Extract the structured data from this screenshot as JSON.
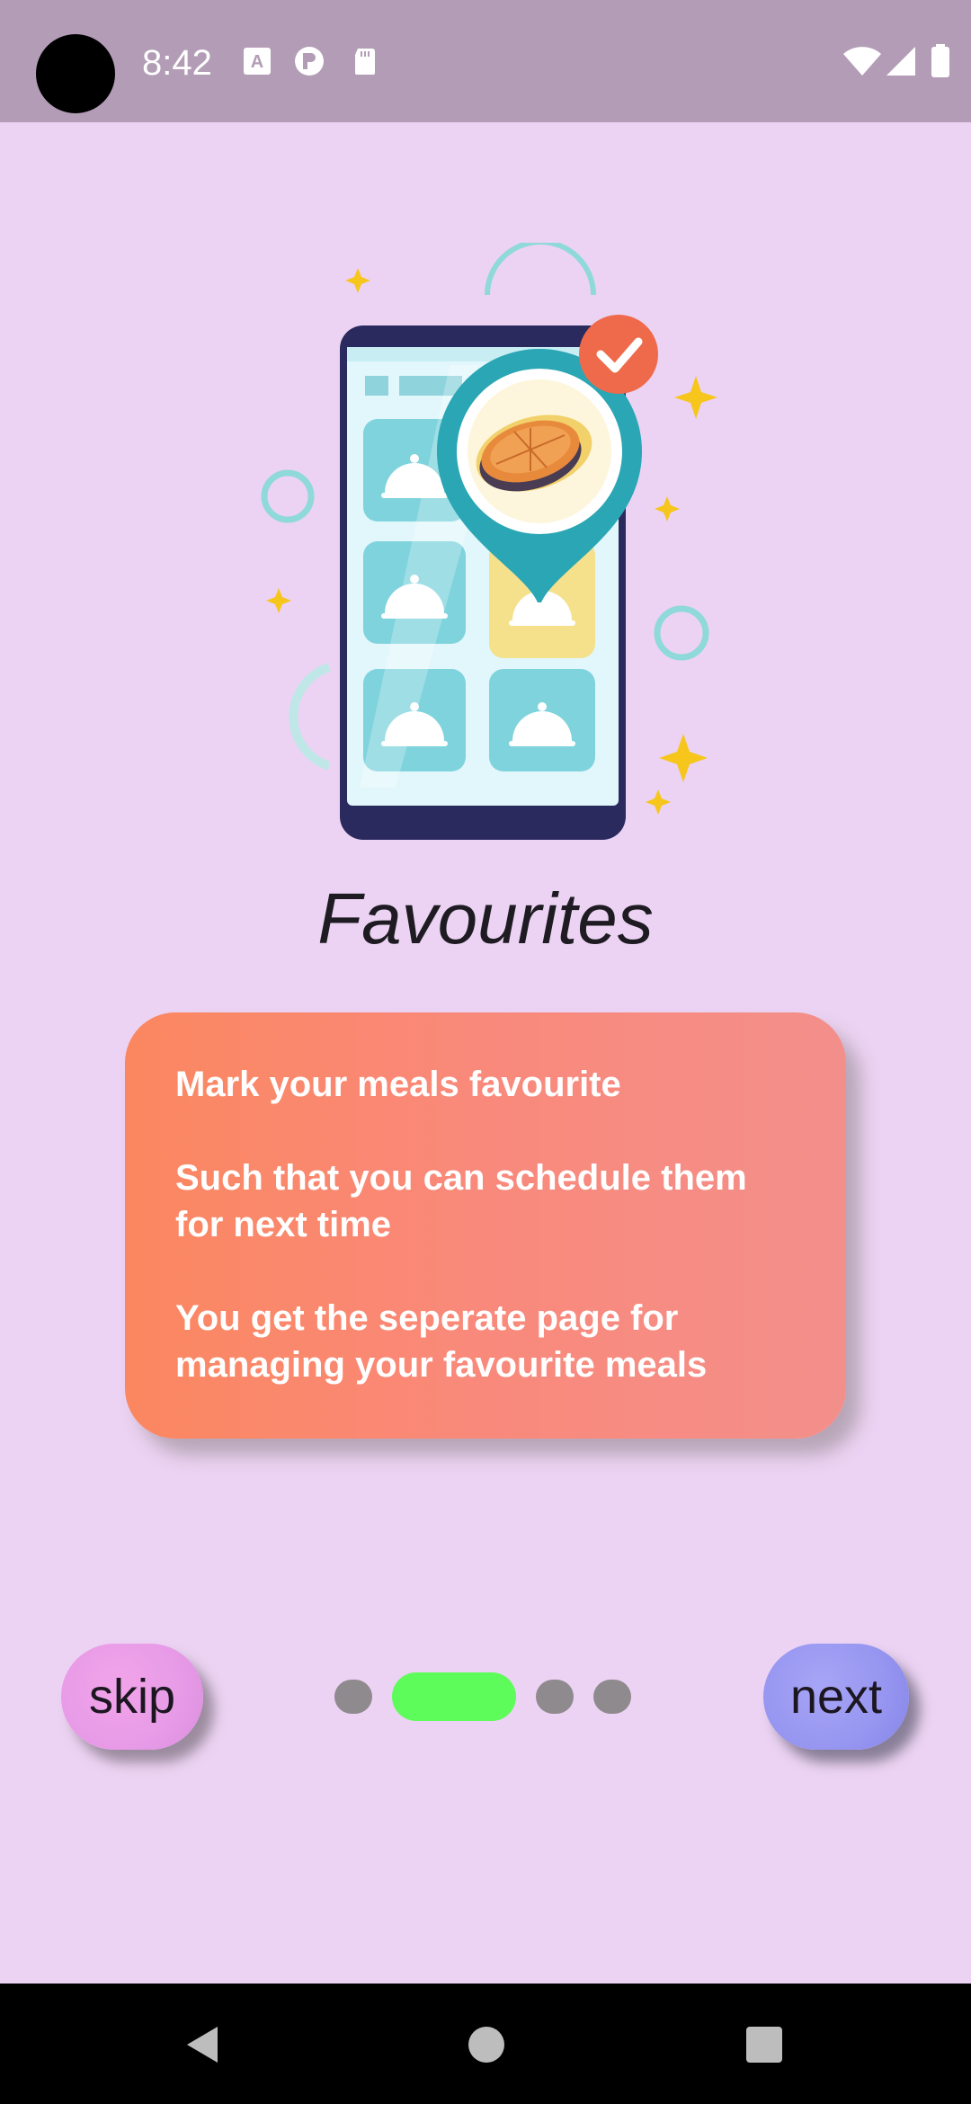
{
  "status_bar": {
    "time": "8:42",
    "left_icons": [
      "a-keyboard-icon",
      "p-badge-icon",
      "sd-card-icon"
    ],
    "right_icons": [
      "wifi-icon",
      "cell-signal-icon",
      "battery-icon"
    ]
  },
  "illustration": {
    "name": "phone-favourite-meal-illustration",
    "colors": {
      "phone_frame": "#2b2a5e",
      "tile": "#7fd3dd",
      "tile_highlight": "#f5e08c",
      "pin": "#2aa6b4",
      "check_badge": "#ee6a4a",
      "sparkle": "#f6c61c"
    }
  },
  "onboarding": {
    "title": "Favourites",
    "card_lines": [
      "Mark your meals favourite",
      "Such that you can schedule them",
      "for next time",
      "You get the seperate page for",
      "managing your favourite meals"
    ],
    "page_count": 4,
    "current_page": 2
  },
  "controls": {
    "skip_label": "skip",
    "next_label": "next",
    "skip_color": "#ec9ee7",
    "next_color": "#9b9af2",
    "active_dot_color": "#5dfc5a",
    "inactive_dot_color": "#8e8a8e"
  },
  "nav_bar": {
    "buttons": [
      "back-triangle-icon",
      "home-circle-icon",
      "recents-square-icon"
    ]
  },
  "colors": {
    "background": "#ecd3f3",
    "status_bar": "#b39cb6",
    "card_gradient_start": "#fb8760",
    "card_gradient_end": "#f38f8b"
  }
}
